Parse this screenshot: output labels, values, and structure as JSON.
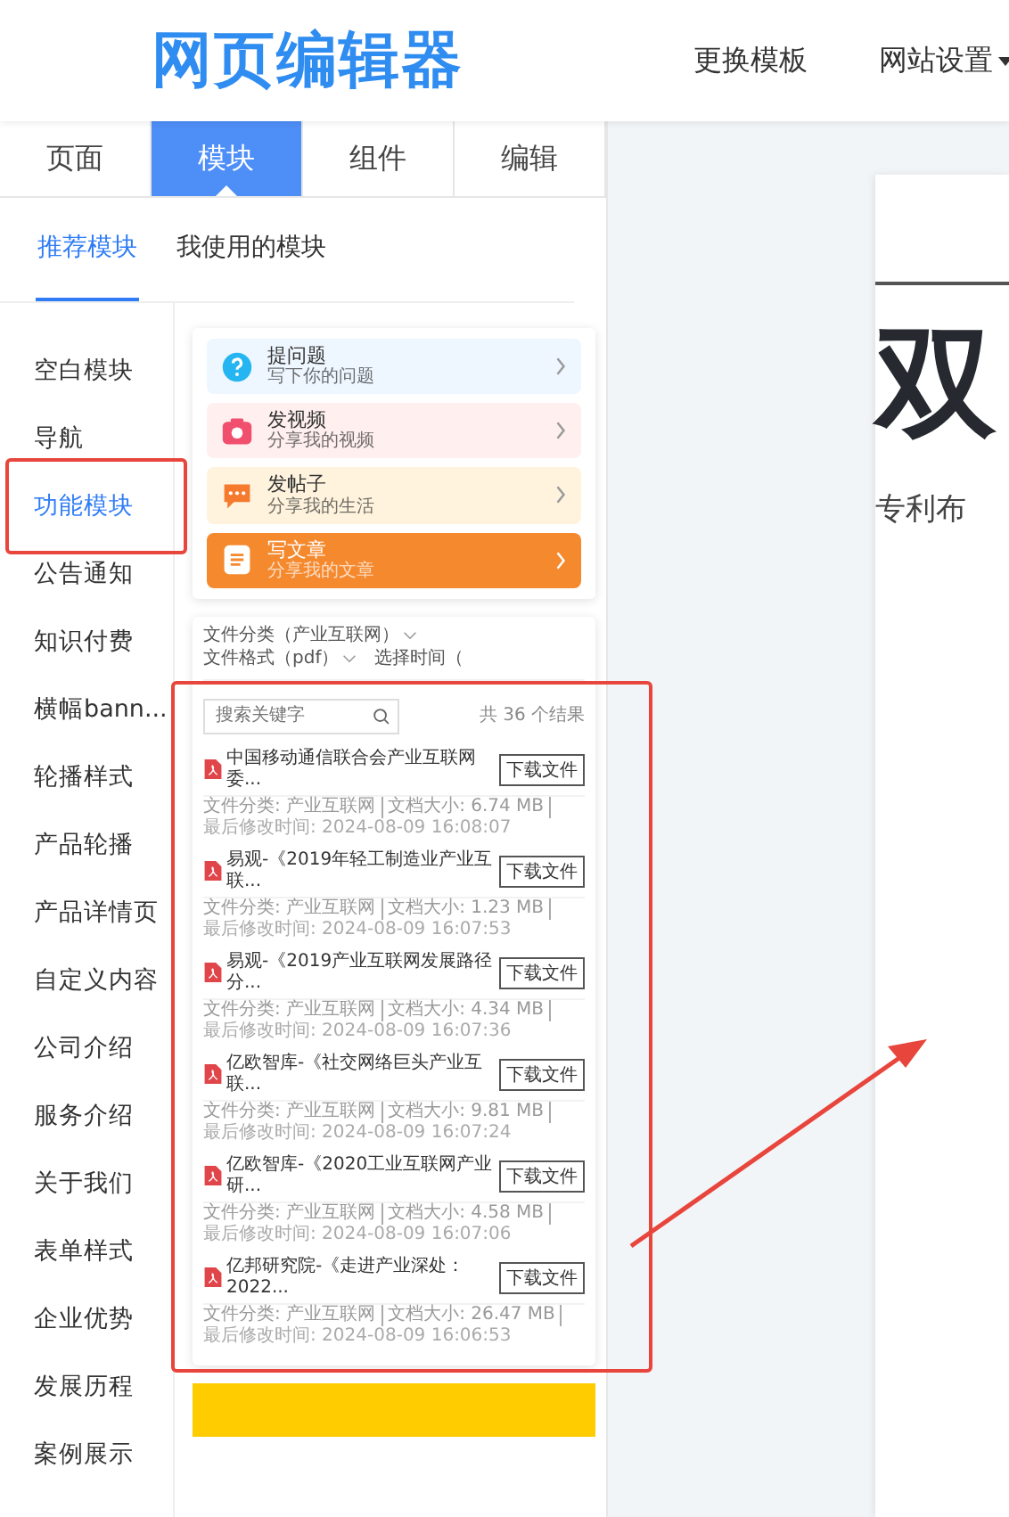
{
  "header": {
    "logo": "网页编辑器",
    "nav": [
      {
        "label": "更换模板",
        "dropdown": false
      },
      {
        "label": "网站设置",
        "dropdown": true
      }
    ]
  },
  "tabs": [
    {
      "label": "页面",
      "selected": false
    },
    {
      "label": "模块",
      "selected": true
    },
    {
      "label": "组件",
      "selected": false
    },
    {
      "label": "编辑",
      "selected": false
    }
  ],
  "subtabs": [
    {
      "label": "推荐模块",
      "selected": true
    },
    {
      "label": "我使用的模块",
      "selected": false
    }
  ],
  "categories": [
    {
      "label": "空白模块",
      "selected": false
    },
    {
      "label": "导航",
      "selected": false
    },
    {
      "label": "功能模块",
      "selected": true,
      "marked": true
    },
    {
      "label": "公告通知",
      "selected": false
    },
    {
      "label": "知识付费",
      "selected": false
    },
    {
      "label": "横幅bann...",
      "selected": false
    },
    {
      "label": "轮播样式",
      "selected": false
    },
    {
      "label": "产品轮播",
      "selected": false
    },
    {
      "label": "产品详情页",
      "selected": false
    },
    {
      "label": "自定义内容",
      "selected": false
    },
    {
      "label": "公司介绍",
      "selected": false
    },
    {
      "label": "服务介绍",
      "selected": false
    },
    {
      "label": "关于我们",
      "selected": false
    },
    {
      "label": "表单样式",
      "selected": false
    },
    {
      "label": "企业优势",
      "selected": false
    },
    {
      "label": "发展历程",
      "selected": false
    },
    {
      "label": "案例展示",
      "selected": false
    }
  ],
  "action_card": {
    "items": [
      {
        "kind": "question",
        "title": "提问题",
        "subtitle": "写下你的问题",
        "color": "#eef7ff",
        "highlighted": false
      },
      {
        "kind": "video",
        "title": "发视频",
        "subtitle": "分享我的视频",
        "color": "#fff0ef",
        "highlighted": false
      },
      {
        "kind": "post",
        "title": "发帖子",
        "subtitle": "分享我的生活",
        "color": "#fff3dd",
        "highlighted": false
      },
      {
        "kind": "article",
        "title": "写文章",
        "subtitle": "分享我的文章",
        "color": "#f5892e",
        "highlighted": true
      }
    ]
  },
  "file_card": {
    "filters": [
      {
        "label": "文件分类（产业互联网）",
        "dropdown": true
      },
      {
        "label": "文件格式（pdf）",
        "dropdown": true
      },
      {
        "label": "选择时间（",
        "dropdown": false
      }
    ],
    "search": {
      "placeholder": "搜索关键字"
    },
    "count": "共 36 个结果",
    "marked": true,
    "files": [
      {
        "title": "中国移动通信联合会产业互联网委...",
        "button": "下载文件",
        "category": "文件分类: 产业互联网",
        "size": "文档大小: 6.74 MB",
        "modified": "最后修改时间: 2024-08-09 16:08:07"
      },
      {
        "title": "易观-《2019年轻工制造业产业互联...",
        "button": "下载文件",
        "category": "文件分类: 产业互联网",
        "size": "文档大小: 1.23 MB",
        "modified": "最后修改时间: 2024-08-09 16:07:53"
      },
      {
        "title": "易观-《2019产业互联网发展路径分...",
        "button": "下载文件",
        "category": "文件分类: 产业互联网",
        "size": "文档大小: 4.34 MB",
        "modified": "最后修改时间: 2024-08-09 16:07:36"
      },
      {
        "title": "亿欧智库-《社交网络巨头产业互联...",
        "button": "下载文件",
        "category": "文件分类: 产业互联网",
        "size": "文档大小: 9.81 MB",
        "modified": "最后修改时间: 2024-08-09 16:07:24"
      },
      {
        "title": "亿欧智库-《2020工业互联网产业研...",
        "button": "下载文件",
        "category": "文件分类: 产业互联网",
        "size": "文档大小: 4.58 MB",
        "modified": "最后修改时间: 2024-08-09 16:07:06"
      },
      {
        "title": "亿邦研究院-《走进产业深处：2022...",
        "button": "下载文件",
        "category": "文件分类: 产业互联网",
        "size": "文档大小: 26.47 MB",
        "modified": "最后修改时间: 2024-08-09 16:06:53"
      }
    ]
  },
  "canvas": {
    "headline": "双",
    "line": "专利布"
  }
}
